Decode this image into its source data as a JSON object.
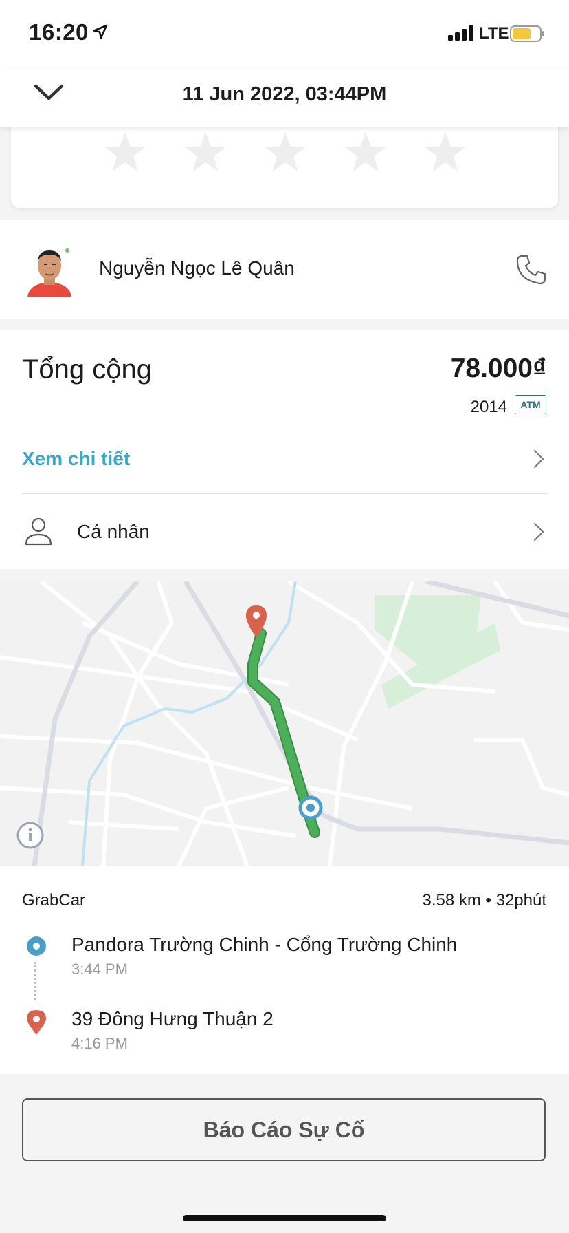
{
  "status_bar": {
    "time": "16:20",
    "network": "LTE"
  },
  "header": {
    "title": "11 Jun 2022, 03:44PM"
  },
  "rating": {
    "stars_total": 5,
    "stars_filled": 0
  },
  "driver": {
    "name": "Nguyễn Ngọc Lê Quân"
  },
  "payment": {
    "total_label": "Tổng cộng",
    "total_amount": "78.000₫",
    "method_code": "2014",
    "method_badge": "ATM",
    "details_link": "Xem chi tiết",
    "profile_label": "Cá nhân"
  },
  "trip": {
    "service": "GrabCar",
    "stats": "3.58 km • 32phút",
    "pickup": {
      "name": "Pandora Trường Chinh - Cổng Trường Chinh",
      "time": "3:44 PM"
    },
    "dropoff": {
      "name": "39 Đông Hưng Thuận 2",
      "time": "4:16 PM"
    }
  },
  "actions": {
    "report_button": "Báo Cáo Sự Cố"
  },
  "colors": {
    "accent_blue": "#3ba6c7",
    "route_green": "#4caf5a",
    "pin_red": "#d9624f",
    "pickup_blue": "#4a9fc8"
  },
  "icons": [
    "location-arrow-icon",
    "signal-icon",
    "battery-icon",
    "chevron-down-icon",
    "star-icon",
    "phone-icon",
    "chevron-right-icon",
    "person-icon",
    "info-icon",
    "pickup-pin-icon",
    "dropoff-pin-icon"
  ]
}
